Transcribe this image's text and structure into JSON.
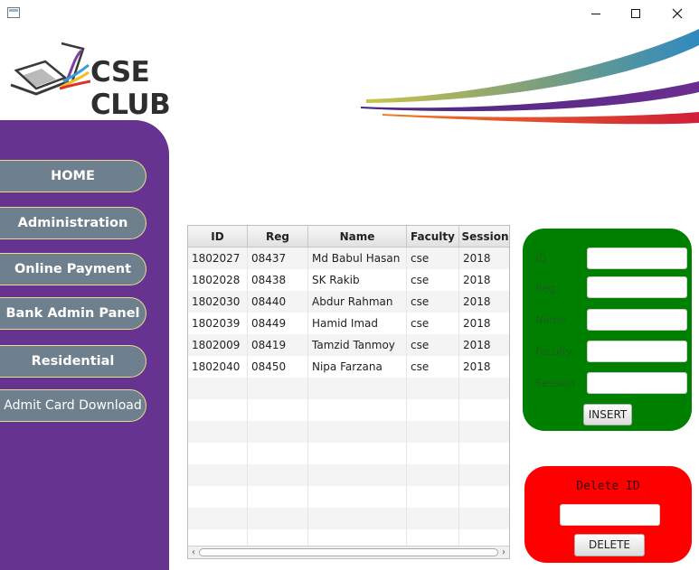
{
  "window": {
    "minimize_glyph": "—",
    "maximize_glyph": "☐",
    "close_glyph": "✕"
  },
  "logo": {
    "text": "CSE CLUB"
  },
  "sidebar": {
    "items": [
      {
        "label": "HOME"
      },
      {
        "label": "Administration"
      },
      {
        "label": "Online Payment"
      },
      {
        "label": "Bank Admin Panel"
      },
      {
        "label": "Residential"
      },
      {
        "label": "Admit Card Download"
      }
    ]
  },
  "table": {
    "columns": [
      "ID",
      "Reg",
      "Name",
      "Faculty",
      "Session"
    ],
    "rows": [
      [
        "1802027",
        "08437",
        "Md Babul Hasan",
        "cse",
        "2018"
      ],
      [
        "1802028",
        "08438",
        "SK Rakib",
        "cse",
        "2018"
      ],
      [
        "1802030",
        "08440",
        "Abdur Rahman",
        "cse",
        "2018"
      ],
      [
        "1802039",
        "08449",
        "Hamid Imad",
        "cse",
        "2018"
      ],
      [
        "1802009",
        "08419",
        "Tamzid Tanmoy",
        "cse",
        "2018"
      ],
      [
        "1802040",
        "08450",
        "Nipa Farzana",
        "cse",
        "2018"
      ]
    ],
    "scroll_left": "‹",
    "scroll_right": "›"
  },
  "insert_panel": {
    "fields": [
      {
        "label": "ID",
        "value": ""
      },
      {
        "label": "Reg",
        "value": ""
      },
      {
        "label": "Name",
        "value": ""
      },
      {
        "label": "Faculty",
        "value": ""
      },
      {
        "label": "Session",
        "value": ""
      }
    ],
    "insert_label": "INSERT"
  },
  "delete_panel": {
    "title": "Delete ID",
    "value": "",
    "delete_label": "DELETE"
  },
  "colors": {
    "sidebar": "#673391",
    "nav_button": "#6e7f8d",
    "nav_border": "#e6df8a",
    "insert_panel": "#008000",
    "delete_panel": "#ff0000"
  }
}
